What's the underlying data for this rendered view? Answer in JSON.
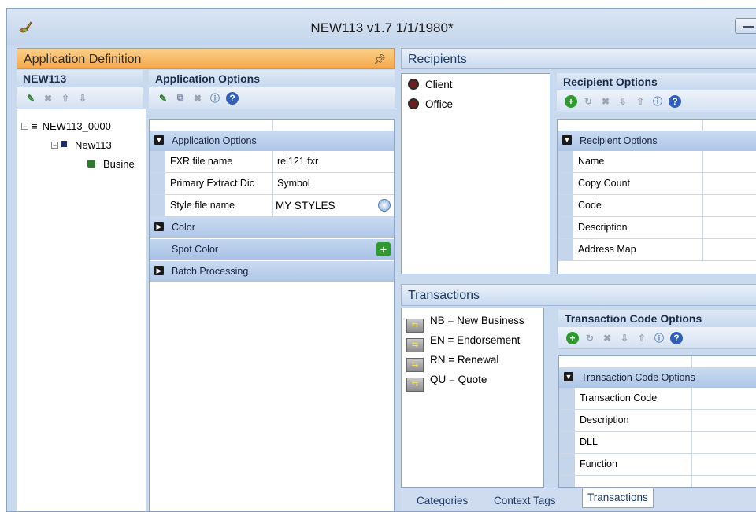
{
  "window": {
    "title": "NEW113 v1.7 1/1/1980*"
  },
  "app_def": {
    "title": "Application Definition",
    "pin_icon": "pin-icon",
    "tree_header": "NEW113",
    "tree": [
      {
        "label": "NEW113_0000",
        "expander": "⊟"
      },
      {
        "label": "New113",
        "expander": "⊟"
      },
      {
        "label": "Busine"
      }
    ]
  },
  "app_options": {
    "header": "Application Options",
    "category": "Application Options",
    "rows": [
      {
        "label": "FXR file name",
        "value": "rel121.fxr"
      },
      {
        "label": "Primary Extract Dic",
        "value": "Symbol"
      },
      {
        "label": "Style file name",
        "value": "MY STYLES"
      }
    ],
    "color_category": "Color",
    "spot_color": "Spot Color",
    "batch_category": "Batch Processing"
  },
  "recipients": {
    "title": "Recipients",
    "items": [
      "Client",
      "Office"
    ],
    "options_header": "Recipient Options",
    "category": "Recipient Options",
    "rows": [
      "Name",
      "Copy Count",
      "Code",
      "Description",
      "Address Map"
    ]
  },
  "transactions": {
    "title": "Transactions",
    "items": [
      "NB = New Business",
      "EN = Endorsement",
      "RN = Renewal",
      "QU = Quote"
    ],
    "options_header": "Transaction Code Options",
    "category": "Transaction Code Options",
    "rows": [
      "Transaction Code",
      "Description",
      "DLL",
      "Function"
    ]
  },
  "tabs": [
    "Categories",
    "Context Tags",
    "Transactions"
  ],
  "active_tab": "Transactions",
  "colors": {
    "orange_header": "#f5a84b",
    "blue_header": "#c9daf0",
    "category_band": "#aec6e6"
  }
}
